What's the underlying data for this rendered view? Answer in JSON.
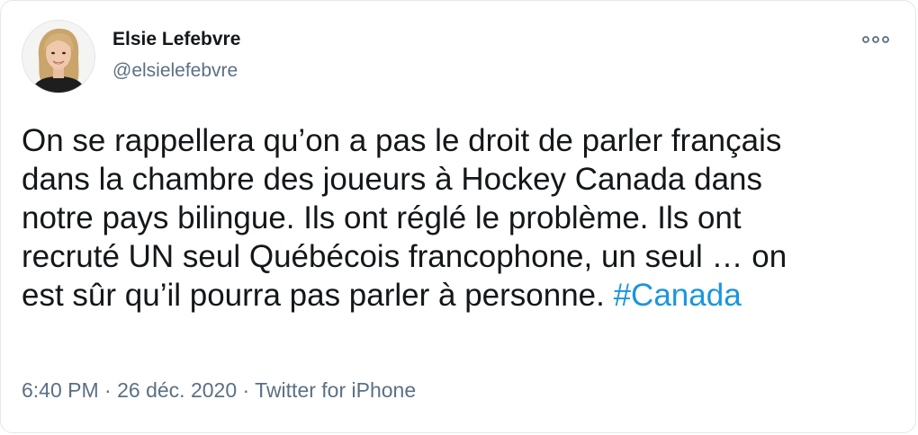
{
  "author": {
    "name": "Elsie Lefebvre",
    "handle": "@elsielefebvre",
    "avatar_icon": "profile-photo"
  },
  "header": {
    "more_icon": "more-options-icon"
  },
  "tweet": {
    "lines": [
      "On se rappellera qu’on a pas le droit de parler français",
      "dans la chambre des joueurs à Hockey Canada dans",
      "notre pays bilingue. Ils ont réglé le problème. Ils ont",
      "recruté UN seul Québécois francophone, un seul … on"
    ],
    "last_line": "est sûr qu’il pourra pas parler à personne.",
    "hashtag": "#Canada"
  },
  "meta": {
    "time": "6:40 PM",
    "separator_1": "·",
    "date": "26 déc. 2020",
    "separator_2": "·",
    "source": "Twitter for iPhone"
  },
  "colors": {
    "text": "#14171a",
    "secondary": "#5b7083",
    "link": "#1b95e0",
    "border": "#e1e8ed"
  }
}
